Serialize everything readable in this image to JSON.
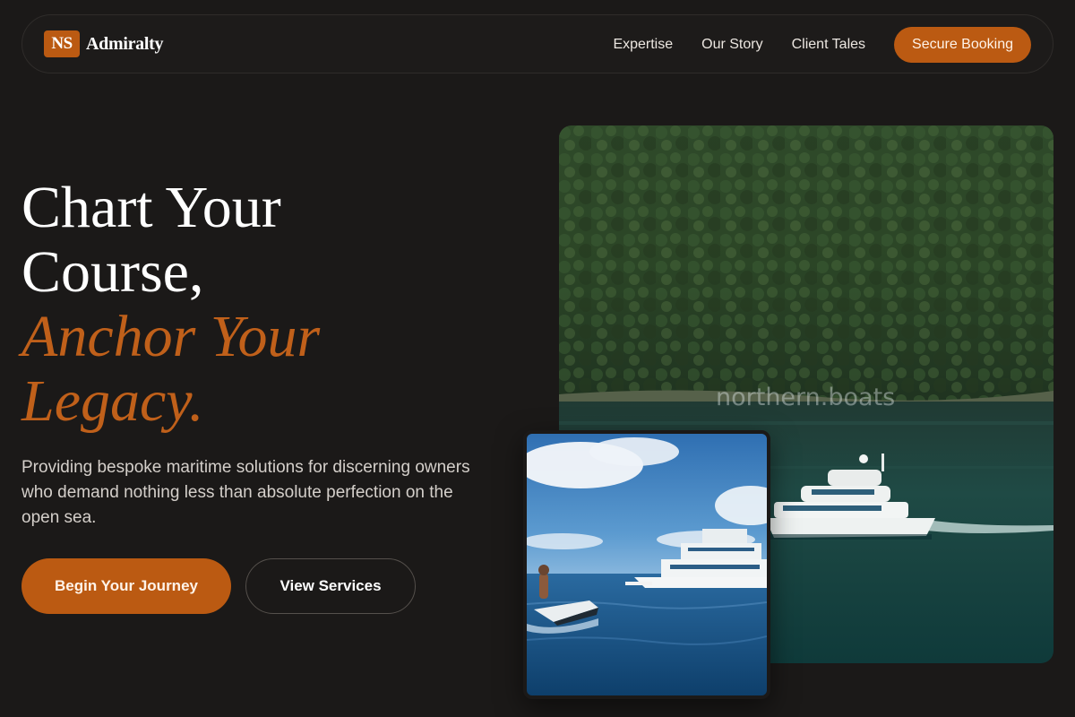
{
  "nav": {
    "logo_mark": "NS",
    "brand": "Admiralty",
    "links": [
      "Expertise",
      "Our Story",
      "Client Tales"
    ],
    "cta": "Secure Booking"
  },
  "hero": {
    "headline_line1": "Chart Your",
    "headline_line2": "Course,",
    "headline_accent1": "Anchor Your",
    "headline_accent2": "Legacy.",
    "lead": "Providing bespoke maritime solutions for discerning owners who demand nothing less than absolute perfection on the open sea.",
    "primary_button": "Begin Your Journey",
    "secondary_button": "View Services"
  },
  "images": {
    "main_watermark": "northern.boats"
  },
  "colors": {
    "accent": "#bb5a12",
    "background": "#1b1918"
  }
}
